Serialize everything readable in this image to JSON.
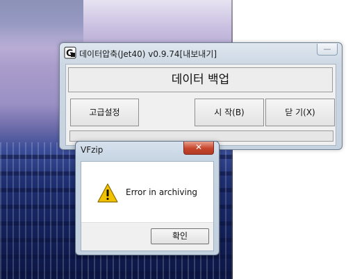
{
  "main_window": {
    "title": "데이터압축(Jet40) v0.9.74[내보내기]",
    "close_label": "—",
    "banner": "데이터 백업",
    "buttons": {
      "advanced_settings": "고급설정",
      "start": "시 작(B)",
      "close": "닫 기(X)"
    },
    "progress": 0
  },
  "dialog": {
    "title": "VFzip",
    "close_label": "✕",
    "message": "Error in archiving",
    "ok_label": "확인"
  },
  "icons": {
    "app": "app-logo-icon",
    "warning": "warning-icon",
    "close": "close-icon"
  },
  "colors": {
    "warning_yellow": "#f2c200",
    "close_red": "#c6442c"
  }
}
